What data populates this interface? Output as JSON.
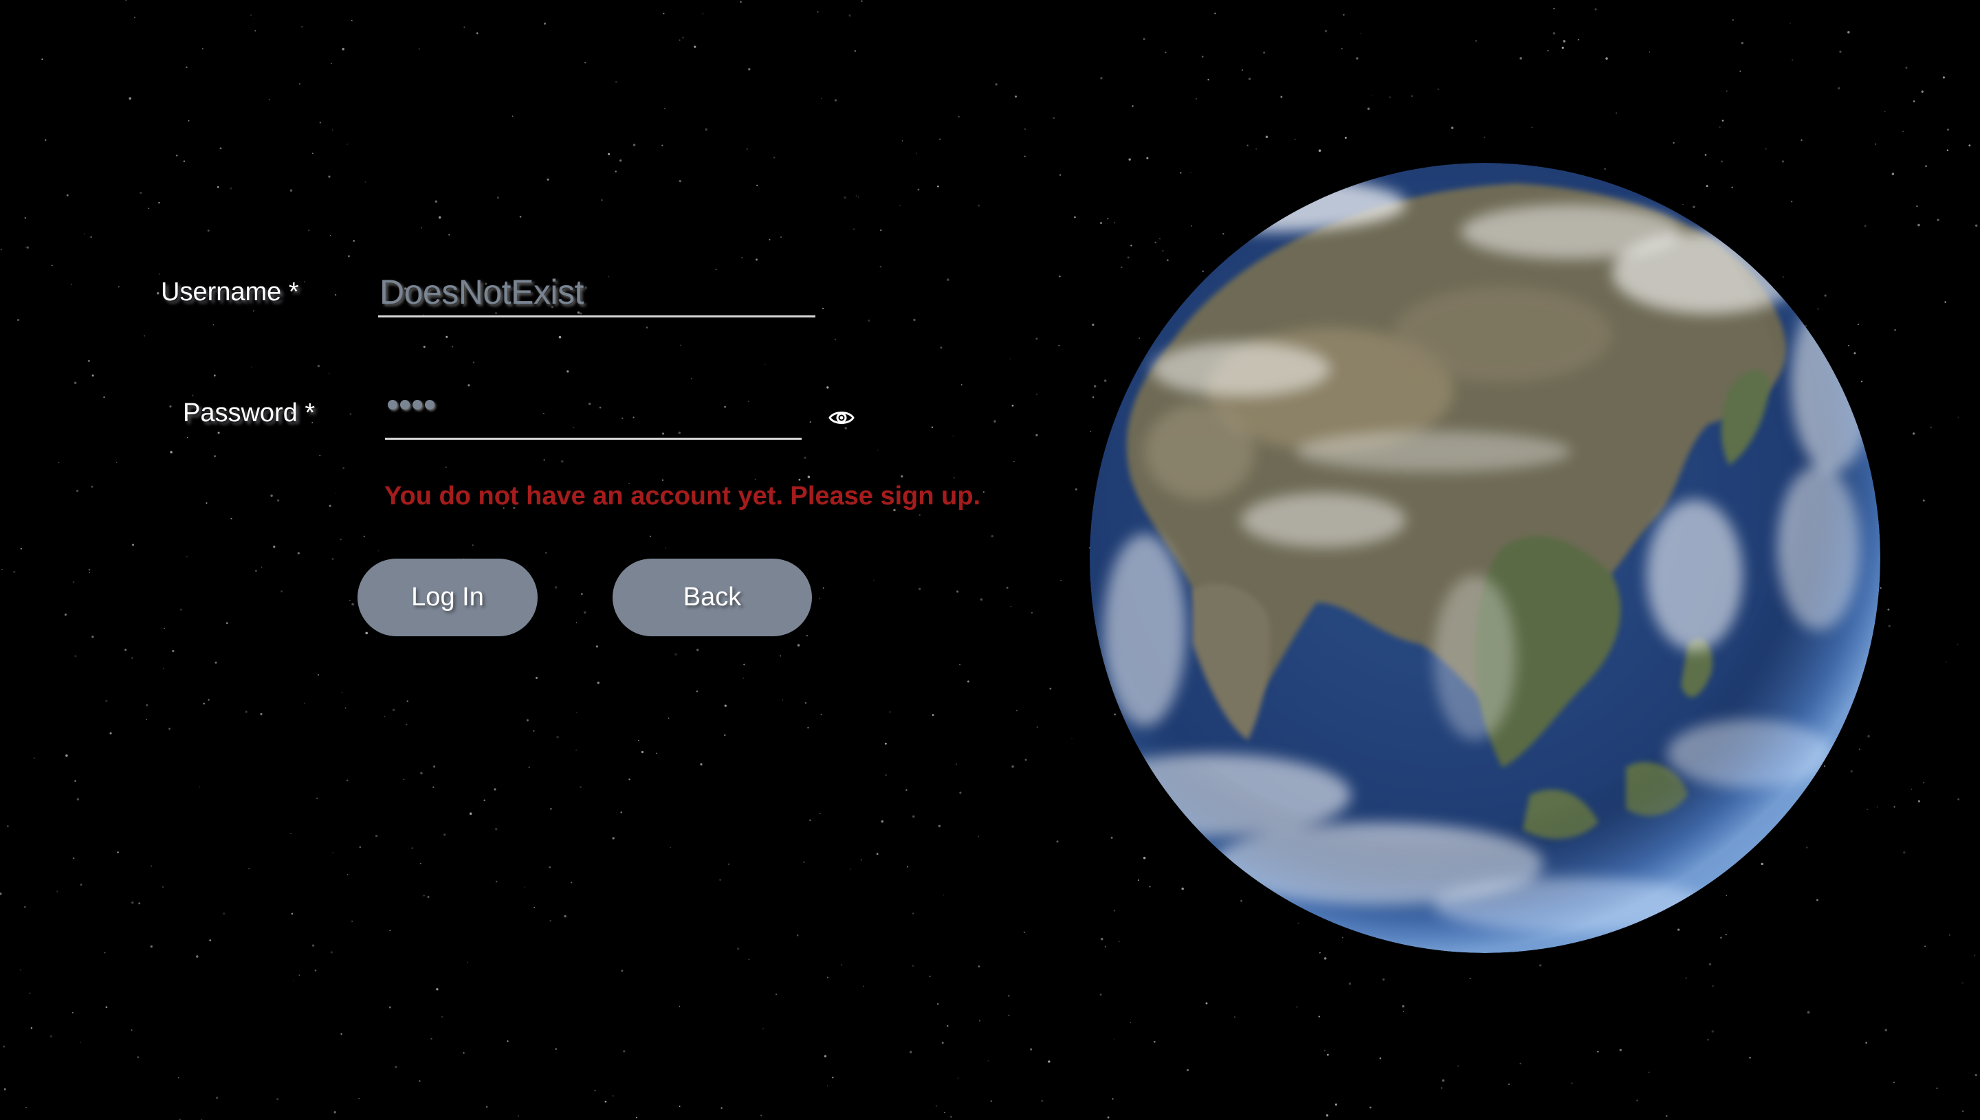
{
  "login": {
    "username_label": "Username *",
    "username_value": "DoesNotExist",
    "password_label": "Password *",
    "password_masked_length": 4,
    "error_message": "You do not have an account yet. Please sign up.",
    "login_button": "Log In",
    "back_button": "Back"
  },
  "icons": {
    "password_toggle": "eye-icon",
    "background": "starfield",
    "globe": "earth-globe"
  },
  "colors": {
    "background": "#000000",
    "error": "#a61c1c",
    "button": "#7b8594",
    "input_text": "#7a8593",
    "label_text": "#ffffff"
  }
}
